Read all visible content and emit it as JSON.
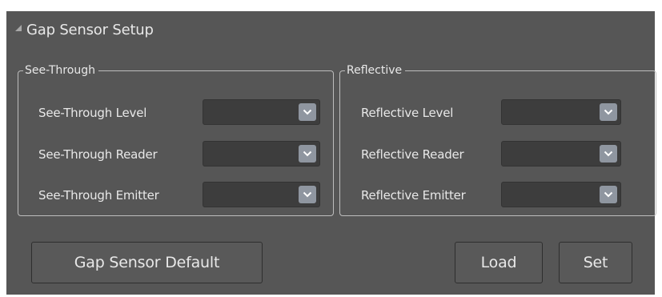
{
  "panel": {
    "title": "Gap Sensor Setup",
    "collapse_icon": "collapse-triangle-icon"
  },
  "see_through": {
    "legend": "See-Through",
    "rows": [
      {
        "label": "See-Through Level",
        "value": ""
      },
      {
        "label": "See-Through Reader",
        "value": ""
      },
      {
        "label": "See-Through Emitter",
        "value": ""
      }
    ]
  },
  "reflective": {
    "legend": "Reflective",
    "rows": [
      {
        "label": "Reflective Level",
        "value": ""
      },
      {
        "label": "Reflective Reader",
        "value": ""
      },
      {
        "label": "Reflective Emitter",
        "value": ""
      }
    ]
  },
  "buttons": {
    "default_label": "Gap Sensor Default",
    "load_label": "Load",
    "set_label": "Set"
  },
  "colors": {
    "panel_bg": "#565656",
    "combo_bg": "#3d3d3d",
    "combo_button": "#8f96a0",
    "text": "#e8e8e8"
  }
}
